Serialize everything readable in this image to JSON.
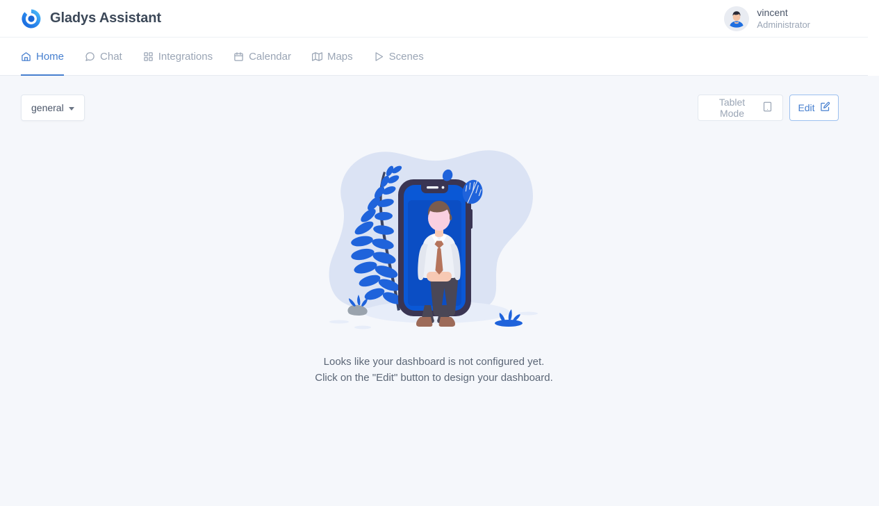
{
  "app": {
    "brand_title": "Gladys Assistant",
    "logo_icon": "gladys-ring-logo",
    "accent_color": "#467fcf",
    "page_background": "#f5f7fb"
  },
  "user": {
    "avatar_icon": "user-avatar",
    "name": "vincent",
    "role": "Administrator"
  },
  "nav": {
    "tabs": [
      {
        "label": "Home",
        "icon": "home-icon",
        "active": true
      },
      {
        "label": "Chat",
        "icon": "chat-icon",
        "active": false
      },
      {
        "label": "Integrations",
        "icon": "grid-icon",
        "active": false
      },
      {
        "label": "Calendar",
        "icon": "calendar-icon",
        "active": false
      },
      {
        "label": "Maps",
        "icon": "map-icon",
        "active": false
      },
      {
        "label": "Scenes",
        "icon": "play-icon",
        "active": false
      }
    ]
  },
  "toolbar": {
    "dashboard_select_label": "general",
    "dashboard_select_icon": "caret-down-icon",
    "tablet_mode_label": "Tablet Mode",
    "tablet_mode_icon": "tablet-icon",
    "edit_label": "Edit",
    "edit_icon": "edit-pencil-icon"
  },
  "empty_state": {
    "illustration_icon": "person-sitting-phone-illustration",
    "line1": "Looks like your dashboard is not configured yet.",
    "line2": "Click on the \"Edit\" button to design your dashboard."
  }
}
